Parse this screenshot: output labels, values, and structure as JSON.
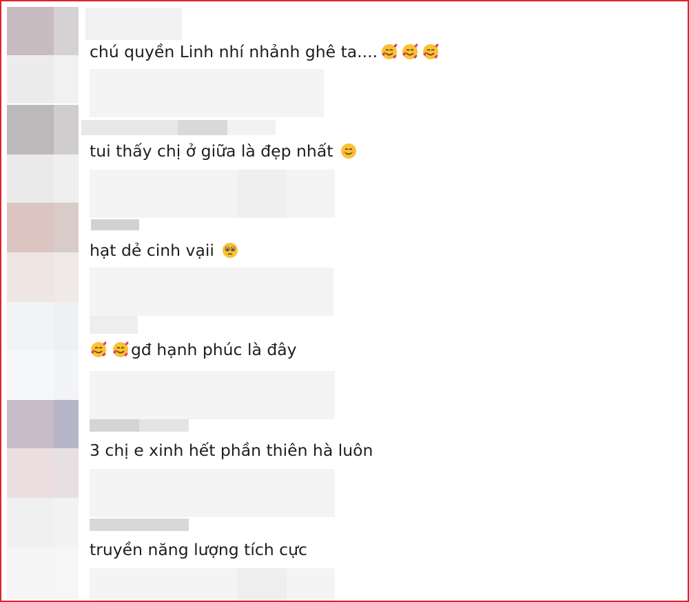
{
  "comments": [
    {
      "text": "chú quyền Linh nhí nhảnh ghê ta....",
      "emojis": [
        "smiling-face-with-hearts-icon",
        "smiling-face-with-hearts-icon",
        "smiling-face-with-hearts-icon"
      ]
    },
    {
      "text": "tui thấy chị ở giữa là đẹp nhất",
      "emojis": [
        "smiling-face-icon"
      ]
    },
    {
      "text": "hạt dẻ cinh vạii",
      "emojis": [
        "pleading-face-icon"
      ]
    },
    {
      "text": "gđ hạnh phúc là đây",
      "leading_emojis": [
        "smiling-face-with-hearts-icon",
        "smiling-face-with-hearts-icon"
      ]
    },
    {
      "text": "3 chị e xinh hết phần thiên hà luôn"
    },
    {
      "text": "truyền năng lượng tích cực"
    }
  ],
  "colors": {
    "border": "#e0222c",
    "text": "#1c1e21",
    "emoji_face": "#f8c233",
    "heart": "#e8336b"
  }
}
